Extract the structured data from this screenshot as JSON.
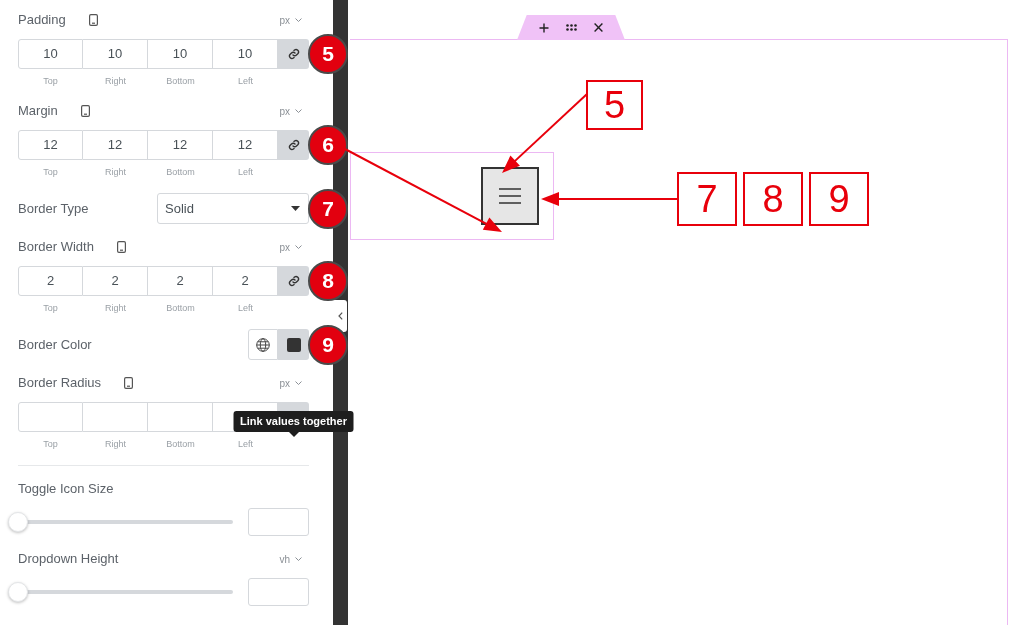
{
  "panel": {
    "controls": [
      {
        "kind": "dimensions",
        "label": "Padding",
        "responsive": true,
        "unit": "px",
        "fields": [
          {
            "caption": "Top",
            "value": "10"
          },
          {
            "caption": "Right",
            "value": "10"
          },
          {
            "caption": "Bottom",
            "value": "10"
          },
          {
            "caption": "Left",
            "value": "10"
          }
        ],
        "linked": true,
        "badge": "5"
      },
      {
        "kind": "dimensions",
        "label": "Margin",
        "responsive": true,
        "unit": "px",
        "fields": [
          {
            "caption": "Top",
            "value": "12"
          },
          {
            "caption": "Right",
            "value": "12"
          },
          {
            "caption": "Bottom",
            "value": "12"
          },
          {
            "caption": "Left",
            "value": "12"
          }
        ],
        "linked": true,
        "badge": "6",
        "arrow": true
      },
      {
        "kind": "select",
        "label": "Border Type",
        "value": "Solid",
        "badge": "7"
      },
      {
        "kind": "dimensions",
        "label": "Border Width",
        "responsive": true,
        "unit": "px",
        "fields": [
          {
            "caption": "Top",
            "value": "2"
          },
          {
            "caption": "Right",
            "value": "2"
          },
          {
            "caption": "Bottom",
            "value": "2"
          },
          {
            "caption": "Left",
            "value": "2"
          }
        ],
        "linked": true,
        "badge": "8"
      },
      {
        "kind": "color",
        "label": "Border Color",
        "color": "#333333",
        "badge": "9"
      },
      {
        "kind": "dimensions",
        "label": "Border Radius",
        "responsive": true,
        "unit": "px",
        "fields": [
          {
            "caption": "Top"
          },
          {
            "caption": "Right"
          },
          {
            "caption": "Bottom"
          },
          {
            "caption": "Left"
          }
        ],
        "linked": true,
        "tooltip": "Link values together"
      },
      {
        "kind": "divider"
      },
      {
        "kind": "slider",
        "label": "Toggle Icon Size",
        "level": 0
      },
      {
        "kind": "slider",
        "label": "Dropdown Height",
        "unit": "vh",
        "level": 0
      }
    ]
  },
  "annotations": {
    "callouts": [
      {
        "labels": [
          "5"
        ],
        "arrow": true
      },
      {
        "labels": [
          "7",
          "8",
          "9"
        ],
        "arrow": true
      }
    ]
  }
}
